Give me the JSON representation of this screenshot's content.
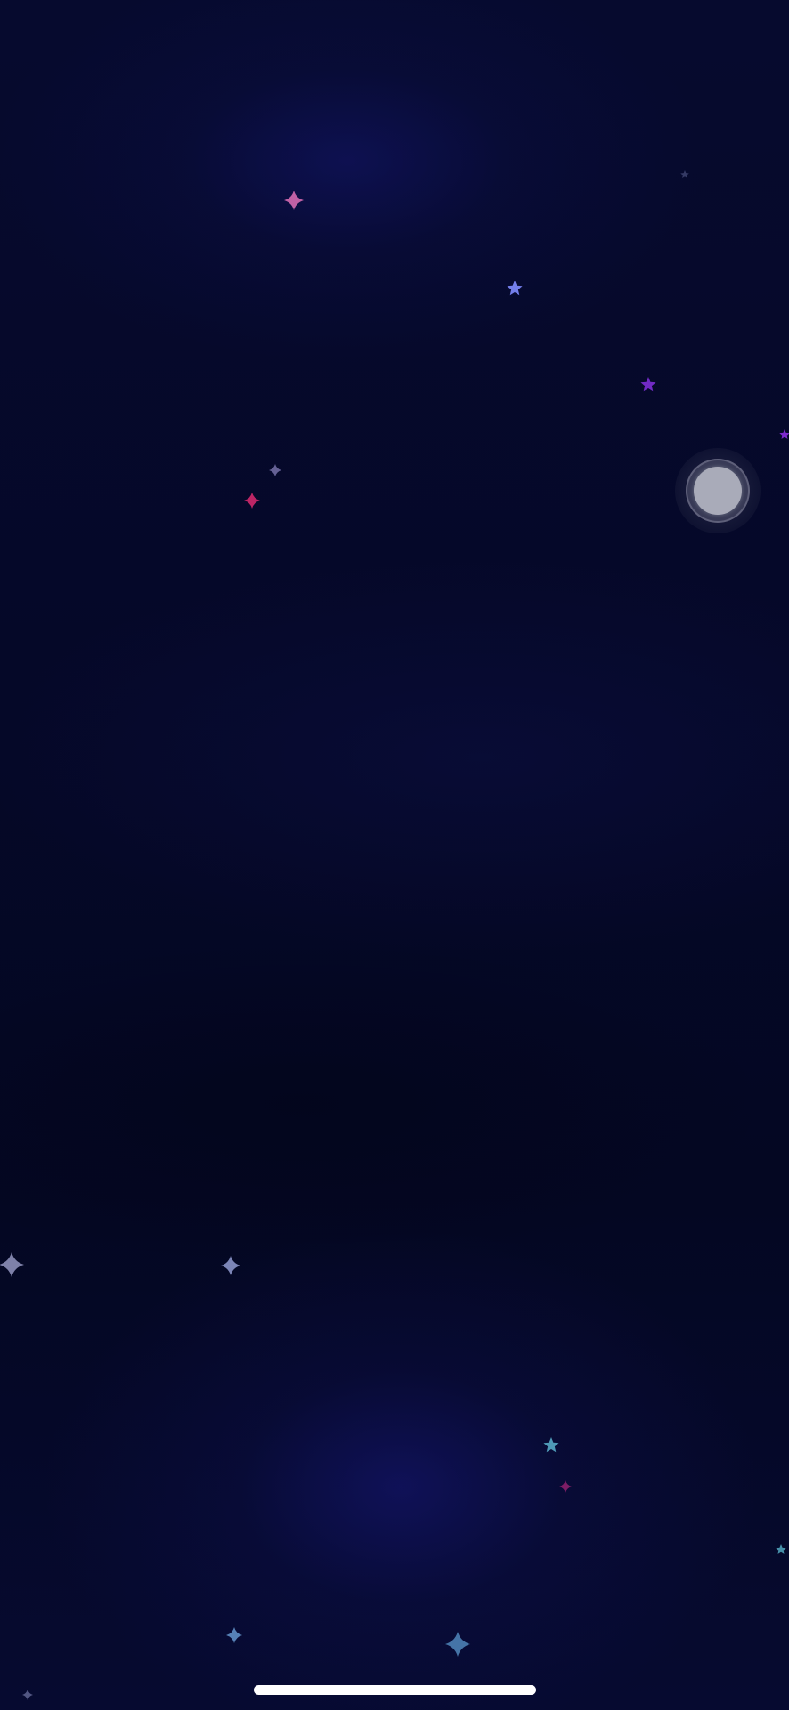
{
  "screen": {
    "background_color": "#050828",
    "accent_glow_color": "#14186e"
  },
  "floating_button": {
    "icon": "assistive-touch-icon",
    "core_color": "#a9abb9"
  },
  "stars": [
    {
      "icon": "sparkle-icon",
      "color": "#d46ab0"
    },
    {
      "icon": "star-icon",
      "color": "#7f8bff"
    },
    {
      "icon": "star-icon",
      "color": "#7d2fd6"
    },
    {
      "icon": "star-icon",
      "color": "#8a2fe0"
    },
    {
      "icon": "sparkle-icon",
      "color": "#6f6aa0"
    },
    {
      "icon": "sparkle-icon",
      "color": "#d0296b"
    },
    {
      "icon": "sparkle-icon",
      "color": "#8c8fb8"
    },
    {
      "icon": "sparkle-icon",
      "color": "#8a94c8"
    },
    {
      "icon": "star-icon",
      "color": "#57a8c4"
    },
    {
      "icon": "sparkle-icon",
      "color": "#8a1f6a"
    },
    {
      "icon": "star-icon",
      "color": "#4fa0b8"
    },
    {
      "icon": "sparkle-icon",
      "color": "#5f8ec4"
    },
    {
      "icon": "sparkle-icon",
      "color": "#4c7fb4"
    },
    {
      "icon": "sparkle-icon",
      "color": "#5a5e8c"
    },
    {
      "icon": "star-icon",
      "color": "#3a3f6a"
    }
  ],
  "home_indicator": {
    "color": "#ffffff"
  }
}
